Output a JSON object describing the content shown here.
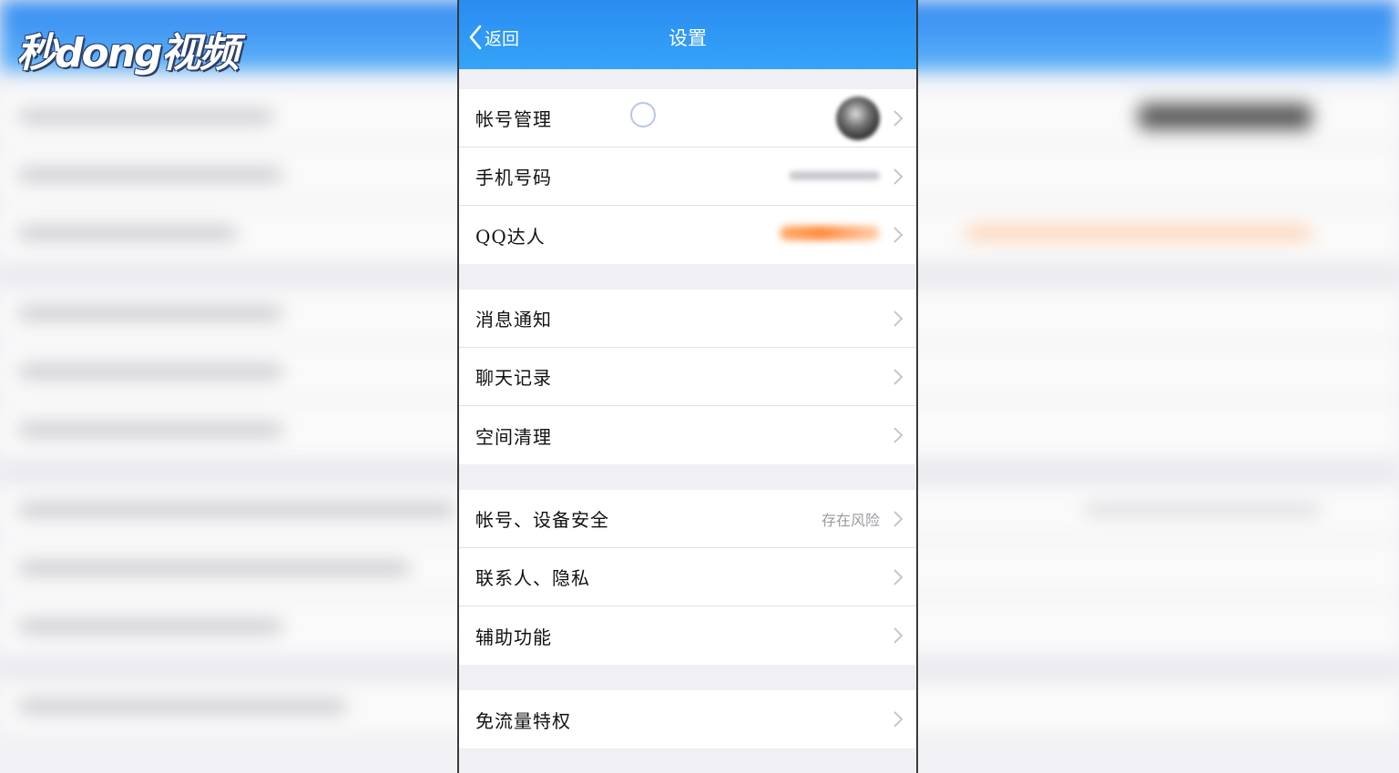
{
  "watermark": {
    "text": "秒dong视频"
  },
  "navbar": {
    "back_label": "返回",
    "title": "设置",
    "color": "#2a8cf1"
  },
  "sections": [
    {
      "items": [
        {
          "label": "帐号管理",
          "extra": "avatar"
        },
        {
          "label": "手机号码",
          "extra": "masked-phone"
        },
        {
          "label": "QQ达人",
          "extra": "masked-badge"
        }
      ]
    },
    {
      "items": [
        {
          "label": "消息通知"
        },
        {
          "label": "聊天记录"
        },
        {
          "label": "空间清理"
        }
      ]
    },
    {
      "items": [
        {
          "label": "帐号、设备安全",
          "detail": "存在风险"
        },
        {
          "label": "联系人、隐私"
        },
        {
          "label": "辅助功能"
        }
      ]
    },
    {
      "items": [
        {
          "label": "免流量特权"
        }
      ]
    }
  ],
  "icons": {
    "back": "chevron-left-icon",
    "row": "chevron-right-icon"
  }
}
